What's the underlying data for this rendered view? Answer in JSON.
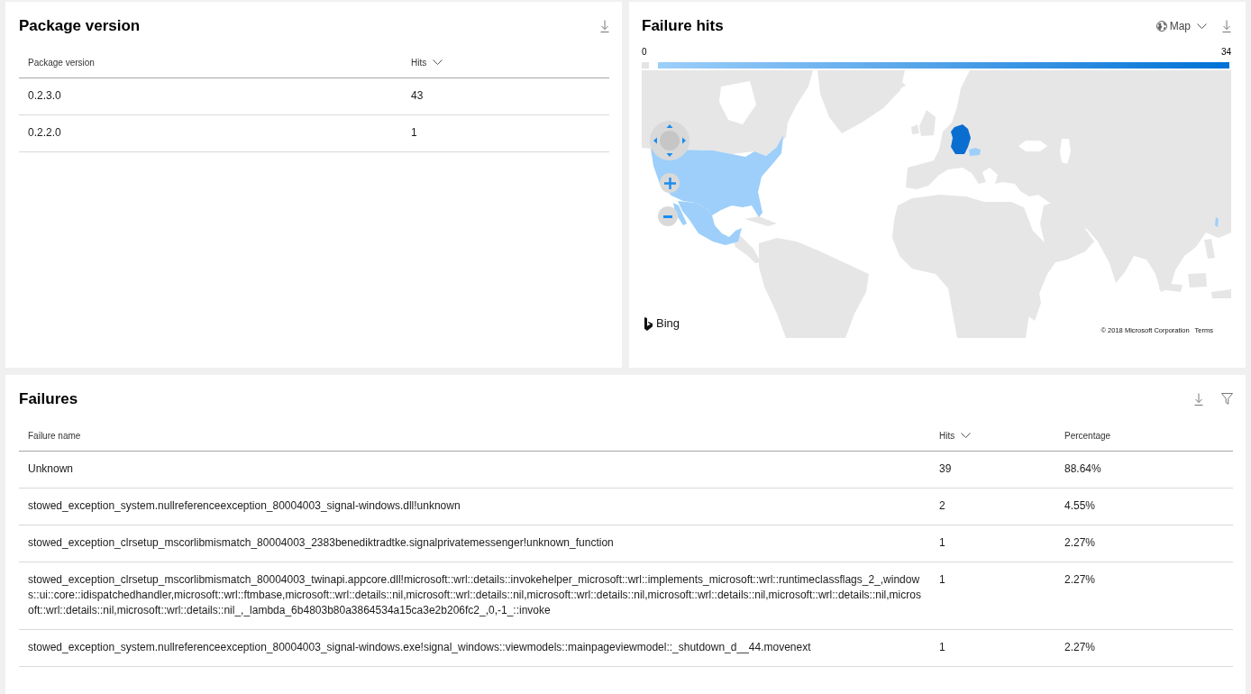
{
  "package_version": {
    "title": "Package version",
    "table": {
      "columns": [
        {
          "label": "Package version",
          "sorted": false
        },
        {
          "label": "Hits",
          "sorted": true
        }
      ],
      "rows": [
        [
          "0.2.3.0",
          "43"
        ],
        [
          "0.2.2.0",
          "1"
        ]
      ]
    }
  },
  "failure_hits": {
    "title": "Failure hits",
    "view_menu": {
      "label": "Map"
    },
    "legend": {
      "min_label": "0",
      "max_label": "34"
    },
    "map": {
      "brand": "Bing",
      "copyright": "© 2018 Microsoft Corporation",
      "terms_link": "Terms"
    }
  },
  "failures": {
    "title": "Failures",
    "table": {
      "columns": [
        {
          "label": "Failure name",
          "sorted": false
        },
        {
          "label": "Hits",
          "sorted": true
        },
        {
          "label": "Percentage",
          "sorted": false
        }
      ],
      "rows": [
        [
          "Unknown",
          "39",
          "88.64%"
        ],
        [
          "stowed_exception_system.nullreferenceexception_80004003_signal-windows.dll!unknown",
          "2",
          "4.55%"
        ],
        [
          "stowed_exception_clrsetup_mscorlibmismatch_80004003_2383benediktradtke.signalprivatemessenger!unknown_function",
          "1",
          "2.27%"
        ],
        [
          "stowed_exception_clrsetup_mscorlibmismatch_80004003_twinapi.appcore.dll!microsoft::wrl::details::invokehelper_microsoft::wrl::implements_microsoft::wrl::runtimeclassflags_2_,windows::ui::core::idispatchedhandler,microsoft::wrl::ftmbase,microsoft::wrl::details::nil,microsoft::wrl::details::nil,microsoft::wrl::details::nil,microsoft::wrl::details::nil,microsoft::wrl::details::nil,microsoft::wrl::details::nil,microsoft::wrl::details::nil_,_lambda_6b4803b80a3864534a15ca3e2b206fc2_,0,-1_::invoke",
          "1",
          "2.27%"
        ],
        [
          "stowed_exception_system.nullreferenceexception_80004003_signal-windows.exe!signal_windows::viewmodels::mainpageviewmodel::_shutdown_d__44.movenext",
          "1",
          "2.27%"
        ]
      ]
    }
  }
}
